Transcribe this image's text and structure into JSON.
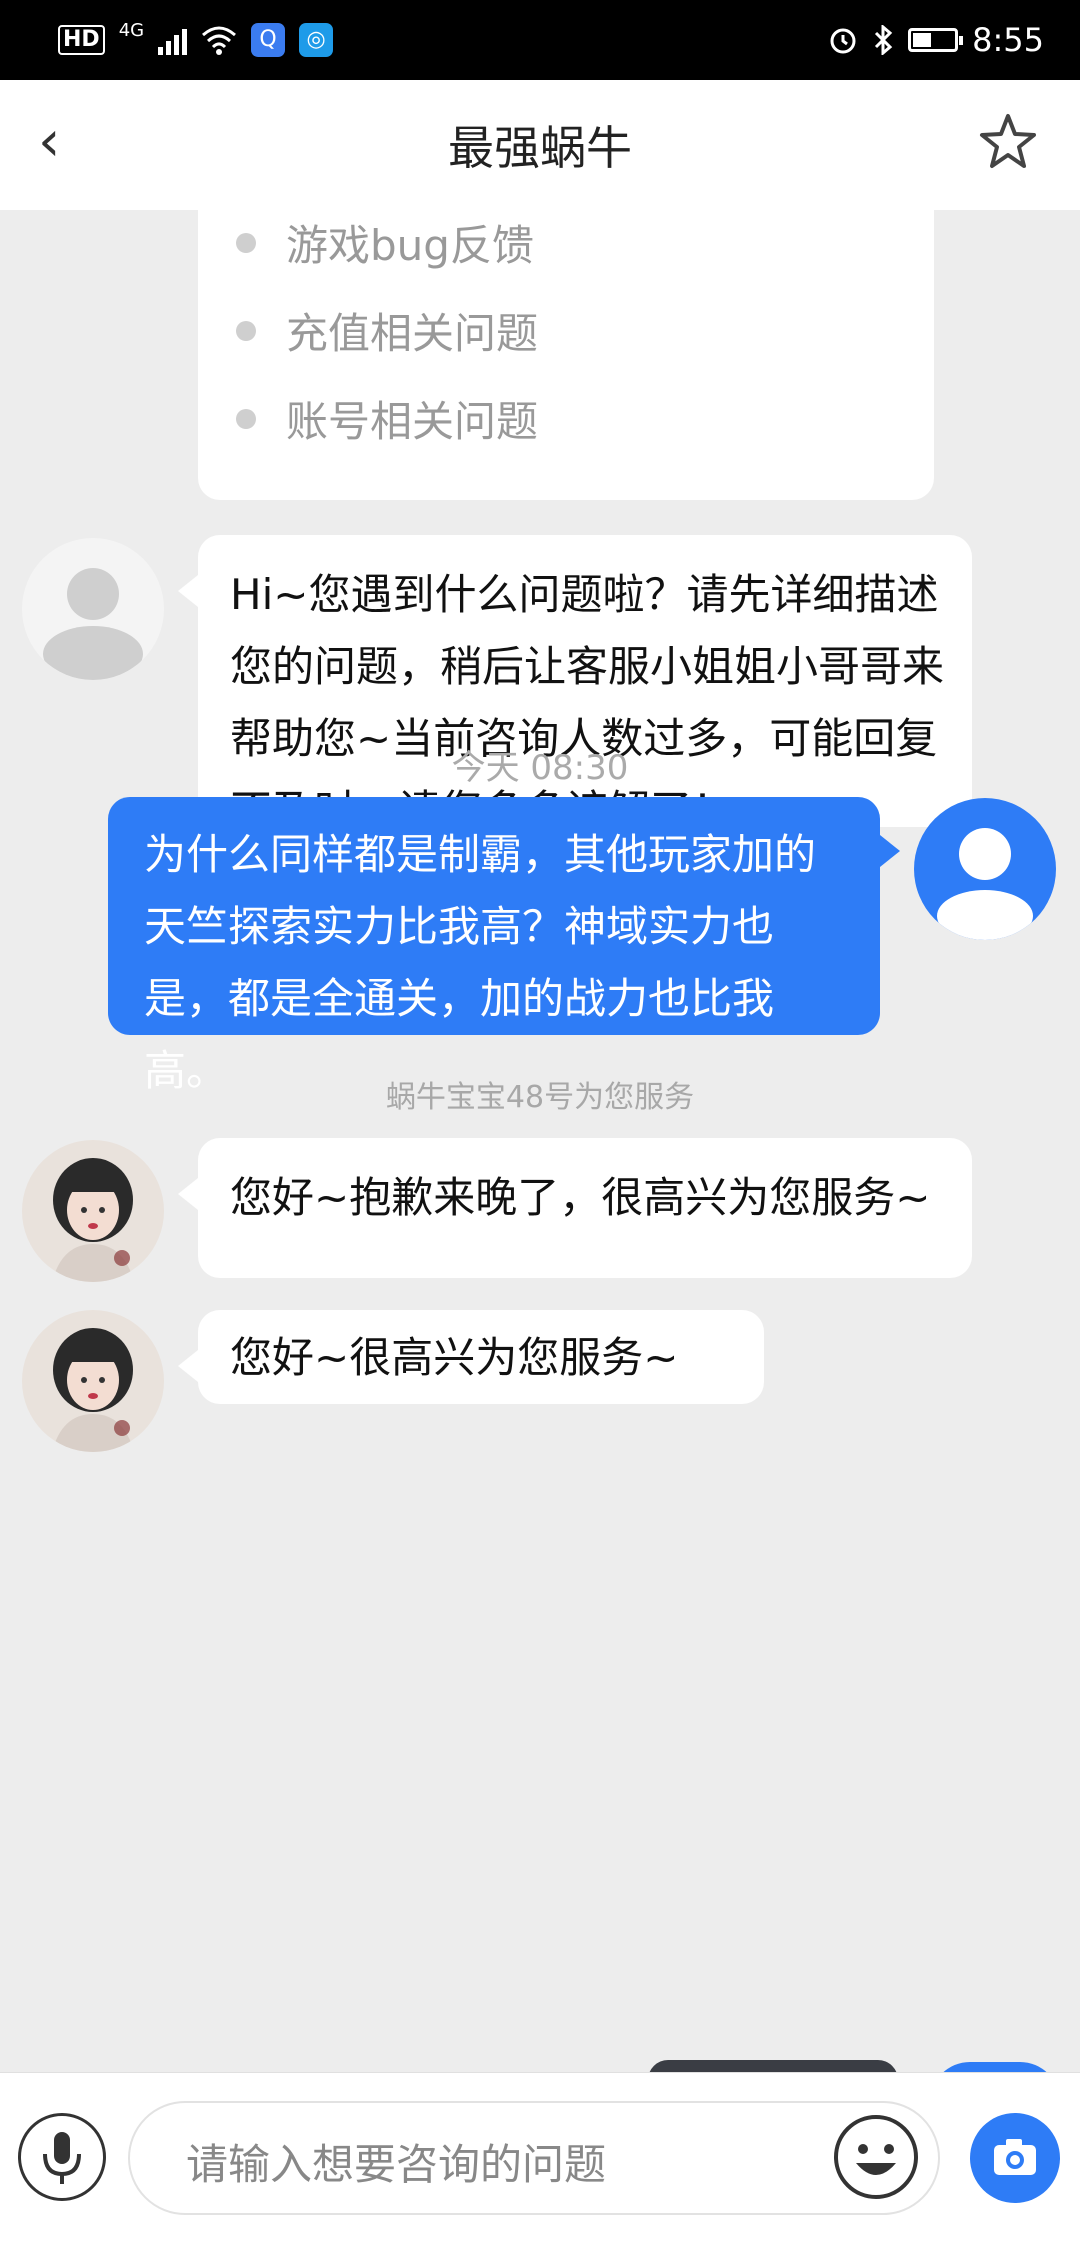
{
  "status_bar": {
    "hd": "HD",
    "network": "4G",
    "time": "8:55"
  },
  "header": {
    "back_icon": "‹",
    "title": "最强蜗牛"
  },
  "menu_card": {
    "items": [
      "游戏bug反馈",
      "充值相关问题",
      "账号相关问题"
    ]
  },
  "messages": {
    "bot_intro": "Hi~您遇到什么问题啦？请先详细描述您的问题，稍后让客服小姐姐小哥哥来帮助您~当前咨询人数过多，可能回复不及时，请您多多谅解了！",
    "timestamp": "今天 08:30",
    "user_question": "为什么同样都是制霸，其他玩家加的天竺探索实力比我高？神域实力也是，都是全通关，加的战力也比我高。",
    "service_notice": "蜗牛宝宝48号为您服务",
    "agent_reply_1": "您好~抱歉来晚了，很高兴为您服务~",
    "agent_reply_2": "您好~很高兴为您服务~"
  },
  "input_bar": {
    "placeholder": "请输入想要咨询的问题"
  },
  "colors": {
    "accent": "#2e7cf6",
    "background": "#ededed"
  },
  "icons": [
    "back-icon",
    "star-icon",
    "mic-icon",
    "emoji-icon",
    "camera-icon"
  ]
}
